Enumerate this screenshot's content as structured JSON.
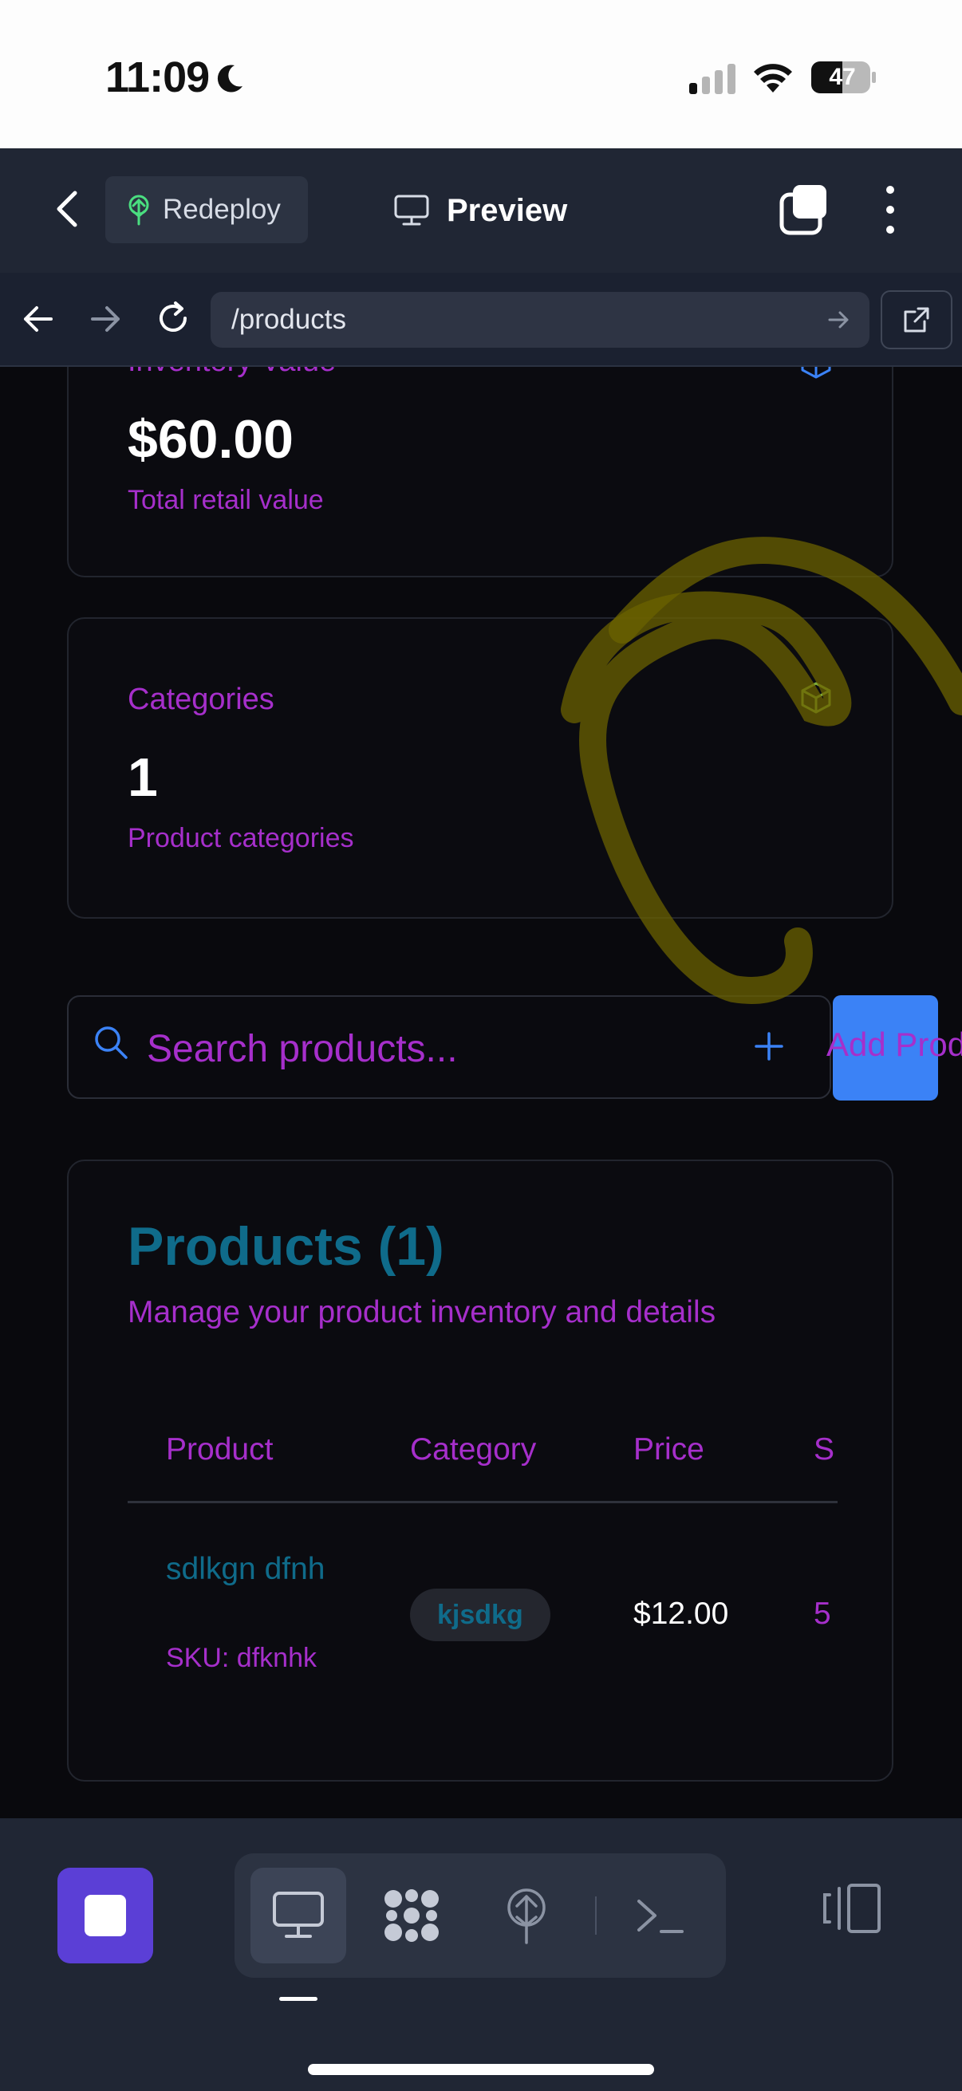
{
  "status_bar": {
    "time": "11:09",
    "battery": "47",
    "icons": [
      "moon-icon",
      "cellular-signal-icon",
      "wifi-icon",
      "battery-icon"
    ]
  },
  "top_bar": {
    "redeploy_label": "Redeploy",
    "preview_label": "Preview",
    "icons": [
      "back-chevron-icon",
      "deploy-tree-icon",
      "monitor-icon",
      "tabs-icon",
      "more-vertical-icon"
    ]
  },
  "url_bar": {
    "url": "/products",
    "icons": [
      "arrow-left-icon",
      "arrow-right-icon",
      "reload-icon",
      "go-arrow-icon",
      "external-link-icon"
    ]
  },
  "cards": {
    "inventory": {
      "label": "Inventory Value",
      "value": "$60.00",
      "sub": "Total retail value",
      "icon": "box-icon",
      "icon_color": "#3b82f6"
    },
    "categories": {
      "label": "Categories",
      "value": "1",
      "sub": "Product categories",
      "icon": "box-icon",
      "icon_color": "#7fae3a"
    }
  },
  "search": {
    "placeholder": "Search products...",
    "add_label": "Add Product"
  },
  "products": {
    "title": "Products (1)",
    "description": "Manage your product inventory and details",
    "columns": [
      "Product",
      "Category",
      "Price",
      "S"
    ],
    "rows": [
      {
        "name": "sdlkgn dfnh",
        "sku": "SKU: dfknhk",
        "category": "kjsdkg",
        "price": "$12.00",
        "stock": "5"
      }
    ]
  },
  "bottom_bar": {
    "icons": [
      "stop-icon",
      "monitor-icon",
      "grid-dots-icon",
      "deploy-tree-icon",
      "terminal-icon",
      "layout-toggle-icon"
    ]
  },
  "colors": {
    "accent_purple": "#a62fcb",
    "accent_teal": "#0f6b8a",
    "primary_blue": "#3b82f6",
    "stop_purple": "#5b3fd6",
    "overlay_yellow": "#8a7d00"
  }
}
